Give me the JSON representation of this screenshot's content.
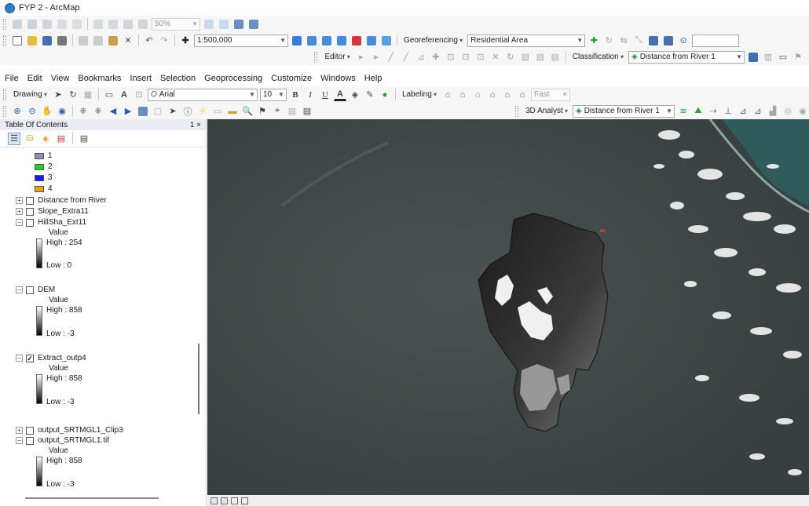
{
  "window": {
    "title": "FYP 2 - ArcMap"
  },
  "toolbars": {
    "row1": {
      "zoom_combo": "50%"
    },
    "row2": {
      "scale_combo": "1:500,000",
      "georeferencing_label": "Georeferencing",
      "georef_layer_combo": "Residential Area"
    },
    "row3": {
      "editor_label": "Editor",
      "classification_label": "Classification",
      "class_layer_combo": "Distance from River 1"
    },
    "drawing": {
      "drawing_label": "Drawing",
      "font_combo": "Arial",
      "size_combo": "10",
      "bold": "B",
      "italic": "I",
      "underline": "U",
      "labeling_label": "Labeling",
      "fast_combo": "Fast"
    },
    "tools": {
      "analyst_label": "3D Analyst",
      "analyst_layer_combo": "Distance from River 1"
    }
  },
  "menubar": {
    "items": [
      "File",
      "Edit",
      "View",
      "Bookmarks",
      "Insert",
      "Selection",
      "Geoprocessing",
      "Customize",
      "Windows",
      "Help"
    ]
  },
  "toc": {
    "title": "Table Of Contents",
    "pin": "1 ×",
    "legend_classes": [
      {
        "label": "1",
        "color": "#8e8ea8"
      },
      {
        "label": "2",
        "color": "#1fd11f"
      },
      {
        "label": "3",
        "color": "#1a1aee"
      },
      {
        "label": "4",
        "color": "#e8a31a"
      }
    ],
    "layers": {
      "distance": {
        "name": "Distance from River",
        "expander": "+",
        "checked": ""
      },
      "slope": {
        "name": "Slope_Extra11",
        "expander": "+",
        "checked": ""
      },
      "hillshade": {
        "name": "HillSha_Ext11",
        "expander": "−",
        "checked": "",
        "value_label": "Value",
        "high": "High : 254",
        "low": "Low : 0"
      },
      "dem": {
        "name": "DEM",
        "expander": "−",
        "checked": "",
        "value_label": "Value",
        "high": "High : 858",
        "low": "Low : -3"
      },
      "extract": {
        "name": "Extract_outp4",
        "expander": "−",
        "checked": "✓",
        "value_label": "Value",
        "high": "High : 858",
        "low": "Low : -3"
      },
      "clip": {
        "name": "output_SRTMGL1_Clip3",
        "expander": "+",
        "checked": ""
      },
      "srtm": {
        "name": "output_SRTMGL1.tif",
        "expander": "−",
        "checked": "",
        "value_label": "Value",
        "high": "High : 858",
        "low": "Low : -3"
      }
    }
  },
  "colors": {
    "toolbar_bg": "#f6f6f6",
    "map_bg": "#3f4748",
    "sea": "#2f5c5a",
    "clouds": "#f2f2f2"
  }
}
